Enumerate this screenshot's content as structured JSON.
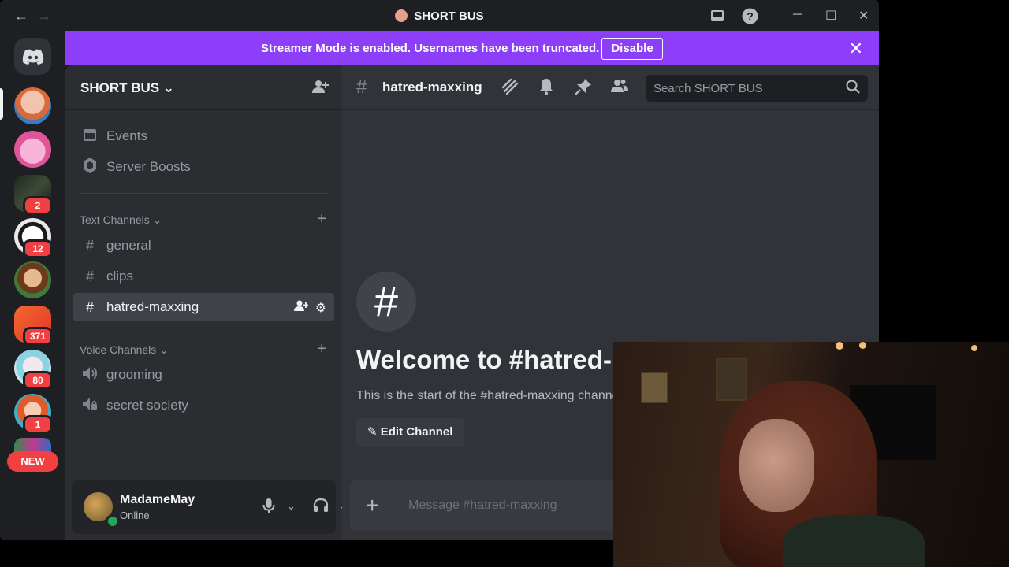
{
  "titlebar": {
    "back": "←",
    "forward": "→",
    "title": "SHORT BUS",
    "inbox_icon": "inbox-icon",
    "help_icon": "help-icon",
    "minimize": "─",
    "maximize": "☐",
    "close": "✕"
  },
  "banner": {
    "text": "Streamer Mode is enabled. Usernames have been truncated.",
    "button": "Disable",
    "close": "✕",
    "color": "#8d3ef8"
  },
  "servers": [
    {
      "name": "server-home",
      "badge": ""
    },
    {
      "name": "server-1",
      "badge": ""
    },
    {
      "name": "server-2",
      "badge": ""
    },
    {
      "name": "server-3",
      "badge": "2"
    },
    {
      "name": "server-4",
      "badge": "12"
    },
    {
      "name": "server-5",
      "badge": ""
    },
    {
      "name": "server-6",
      "badge": "371"
    },
    {
      "name": "server-7",
      "badge": "80"
    },
    {
      "name": "server-8",
      "badge": "1"
    }
  ],
  "new_badge": "NEW",
  "sidebar": {
    "server_name": "SHORT BUS ⌄",
    "events": "Events",
    "boosts": "Server Boosts",
    "text_category": "Text Channels ⌄",
    "voice_category": "Voice Channels ⌄",
    "text_channels": [
      "general",
      "clips",
      "hatred-maxxing"
    ],
    "voice_channels": [
      "grooming",
      "secret society"
    ]
  },
  "user": {
    "name": "MadameMay",
    "status": "Online"
  },
  "channel": {
    "name": "hatred-maxxing",
    "search_placeholder": "Search SHORT BUS",
    "welcome_title": "Welcome to #hatred-maxxing!",
    "welcome_sub": "This is the start of the #hatred-maxxing channel.",
    "edit_button": "Edit Channel",
    "composer_placeholder": "Message #hatred-maxxing"
  },
  "colors": {
    "accent": "#8d3ef8",
    "online": "#23a55a",
    "badge": "#f23f42"
  }
}
